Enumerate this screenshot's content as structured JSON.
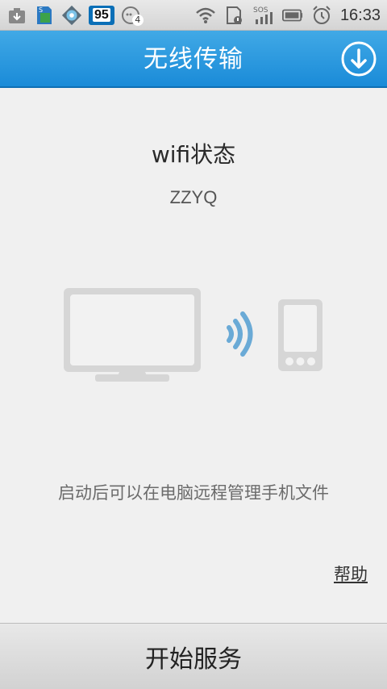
{
  "status_bar": {
    "battery_level": "95",
    "notification_count": "4",
    "time": "16:33",
    "icons": [
      "download-icon",
      "sd-card-icon",
      "network-service-icon",
      "battery-badge-icon",
      "message-icon",
      "wifi-icon",
      "storage-warning-icon",
      "sos-signal-icon",
      "battery-icon",
      "alarm-icon"
    ]
  },
  "header": {
    "title": "无线传输",
    "download_icon": "download-circle-icon"
  },
  "main": {
    "wifi_status_label": "wifi状态",
    "ssid": "ZZYQ",
    "illustration_icons": [
      "monitor-icon",
      "wireless-waves-icon",
      "phone-icon"
    ],
    "tip": "启动后可以在电脑远程管理手机文件",
    "help_link": "帮助"
  },
  "footer": {
    "start_button": "开始服务"
  },
  "colors": {
    "header_blue": "#1a8bd8",
    "wave_blue": "#6aaad6",
    "device_gray": "#d9d9d9"
  }
}
